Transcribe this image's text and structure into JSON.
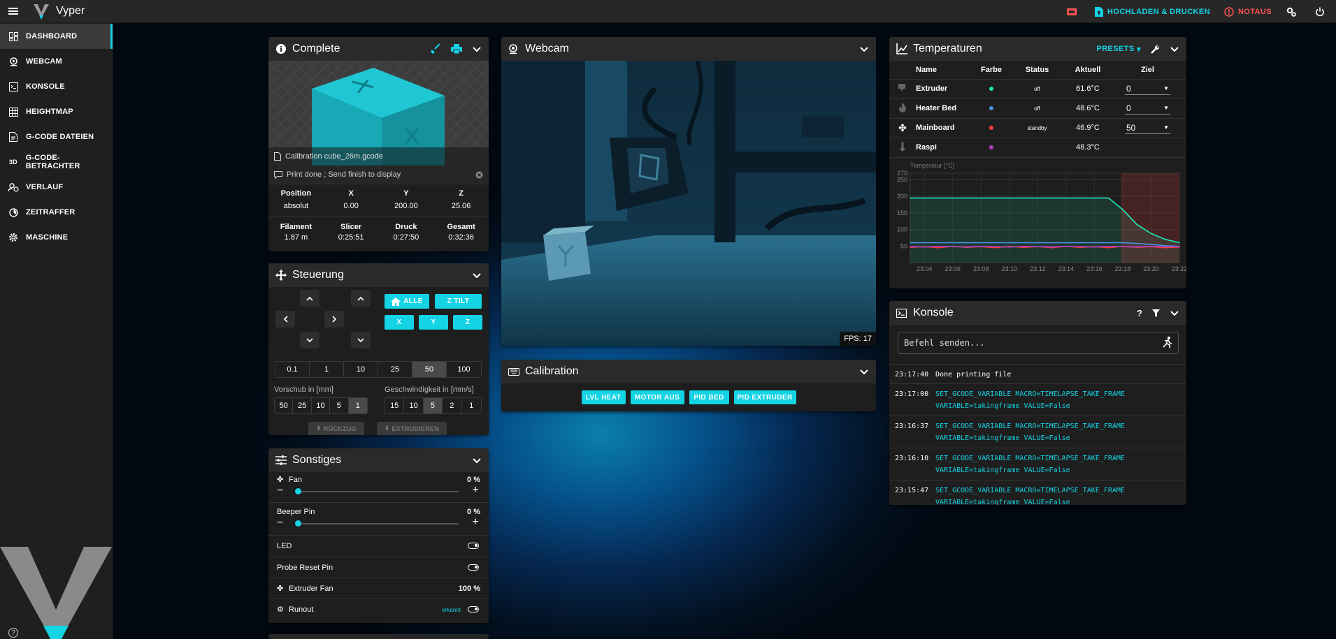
{
  "app": {
    "title": "Vyper"
  },
  "topbar": {
    "upload_label": "HOCHLADEN & DRUCKEN",
    "estop_label": "NOTAUS"
  },
  "sidebar": {
    "items": [
      {
        "label": "DASHBOARD",
        "icon": "dashboard-icon",
        "active": true
      },
      {
        "label": "WEBCAM",
        "icon": "webcam-icon"
      },
      {
        "label": "KONSOLE",
        "icon": "console-icon"
      },
      {
        "label": "HEIGHTMAP",
        "icon": "grid-icon"
      },
      {
        "label": "G-CODE DATEIEN",
        "icon": "file-icon"
      },
      {
        "label": "G-CODE-BETRACHTER",
        "icon": "3d-icon",
        "short": "3D"
      },
      {
        "label": "VERLAUF",
        "icon": "history-icon"
      },
      {
        "label": "ZEITRAFFER",
        "icon": "timelapse-icon"
      },
      {
        "label": "MASCHINE",
        "icon": "gear-icon"
      }
    ]
  },
  "status": {
    "title": "Complete",
    "filename": "Calibration cube_26m.gcode",
    "message": "Print done ; Send finish to display",
    "position": {
      "headers": [
        "Position",
        "X",
        "Y",
        "Z"
      ],
      "values": [
        "absolut",
        "0.00",
        "200.00",
        "25.06"
      ]
    },
    "stats": {
      "headers": [
        "Filament",
        "Slicer",
        "Druck",
        "Gesamt"
      ],
      "values": [
        "1.87 m",
        "0:25:51",
        "0:27:50",
        "0:32:36"
      ]
    }
  },
  "control": {
    "title": "Steuerung",
    "home_all": "ALLE",
    "z_tilt": "Z TILT",
    "home_x": "X",
    "home_y": "Y",
    "home_z": "Z",
    "steps": [
      "0.1",
      "1",
      "10",
      "25",
      "50",
      "100"
    ],
    "steps_selected": 4,
    "feed_label": "Vorschub in [mm]",
    "feed": [
      "50",
      "25",
      "10",
      "5",
      "1"
    ],
    "feed_selected": 4,
    "speed_label": "Geschwindigkeit in [mm/s]",
    "speed": [
      "15",
      "10",
      "5",
      "2",
      "1"
    ],
    "speed_selected": 2,
    "retract": "RÜCKZUG",
    "extrude": "EXTRUDIEREN"
  },
  "misc": {
    "title": "Sonstiges",
    "fan": {
      "label": "Fan",
      "value": "0 %",
      "level": 0
    },
    "beeper": {
      "label": "Beeper Pin",
      "value": "0 %",
      "level": 0
    },
    "led": {
      "label": "LED"
    },
    "probe": {
      "label": "Probe Reset Pin"
    },
    "extruder_fan": {
      "label": "Extruder Fan",
      "value": "100 %"
    },
    "runout": {
      "label": "Runout",
      "status": "erkannt"
    }
  },
  "webcam": {
    "title": "Webcam",
    "fps": "FPS: 17"
  },
  "calibration": {
    "title": "Calibration",
    "buttons": [
      "LVL HEAT",
      "MOTOR AUS",
      "PID BED",
      "PID EXTRUDER"
    ]
  },
  "temps": {
    "title": "Temperaturen",
    "presets": "PRESETS",
    "headers": [
      "Name",
      "Farbe",
      "Status",
      "Aktuell",
      "Ziel"
    ],
    "rows": [
      {
        "name": "Extruder",
        "color": "#1de9b6",
        "status": "off",
        "current": "61.6°C",
        "target": "0"
      },
      {
        "name": "Heater Bed",
        "color": "#4a90e2",
        "status": "off",
        "current": "48.6°C",
        "target": "0"
      },
      {
        "name": "Mainboard",
        "color": "#ff3b3b",
        "status": "standby",
        "current": "46.9°C",
        "target": "50"
      },
      {
        "name": "Raspi",
        "color": "#b040c0",
        "status": "",
        "current": "48.3°C",
        "target": ""
      }
    ]
  },
  "chart_data": {
    "type": "line",
    "ylabel": "Temperatur [°C]",
    "ylim": [
      0,
      270
    ],
    "yticks": [
      50,
      100,
      150,
      200,
      250,
      270
    ],
    "x": [
      "23:03",
      "23:04",
      "23:05",
      "23:06",
      "23:07",
      "23:08",
      "23:09",
      "23:10",
      "23:11",
      "23:12",
      "23:13",
      "23:14",
      "23:15",
      "23:16",
      "23:17",
      "23:18",
      "23:19",
      "23:20",
      "23:21",
      "23:22"
    ],
    "xticks": [
      "23:04",
      "23:06",
      "23:08",
      "23:10",
      "23:12",
      "23:14",
      "23:16",
      "23:18",
      "23:20",
      "23:22"
    ],
    "series": [
      {
        "color": "#1de9b6",
        "values": [
          195,
          195,
          195,
          195,
          195,
          195,
          195,
          195,
          195,
          195,
          195,
          195,
          195,
          195,
          195,
          160,
          115,
          88,
          70,
          60
        ]
      },
      {
        "color": "#4a90e2",
        "values": [
          60,
          60,
          60,
          60,
          60,
          60,
          60,
          60,
          60,
          60,
          60,
          60,
          60,
          60,
          60,
          60,
          58,
          55,
          51,
          49
        ]
      },
      {
        "color": "#ff3b3b",
        "values": [
          46,
          48,
          45,
          49,
          46,
          48,
          45,
          49,
          46,
          48,
          45,
          49,
          46,
          48,
          45,
          49,
          46,
          48,
          45,
          47
        ]
      },
      {
        "color": "#b040c0",
        "values": [
          48,
          47,
          49,
          48,
          47,
          49,
          48,
          47,
          49,
          48,
          47,
          49,
          48,
          47,
          49,
          48,
          47,
          49,
          48,
          48
        ]
      }
    ]
  },
  "console": {
    "title": "Konsole",
    "placeholder": "Befehl senden...",
    "entries": [
      {
        "time": "23:17:40",
        "msg": "Done printing file",
        "plain": true
      },
      {
        "time": "23:17:00",
        "msg": "SET_GCODE_VARIABLE MACRO=TIMELAPSE_TAKE_FRAME VARIABLE=takingframe VALUE=False"
      },
      {
        "time": "23:16:37",
        "msg": "SET_GCODE_VARIABLE MACRO=TIMELAPSE_TAKE_FRAME VARIABLE=takingframe VALUE=False"
      },
      {
        "time": "23:16:10",
        "msg": "SET_GCODE_VARIABLE MACRO=TIMELAPSE_TAKE_FRAME VARIABLE=takingframe VALUE=False"
      },
      {
        "time": "23:15:47",
        "msg": "SET_GCODE_VARIABLE MACRO=TIMELAPSE_TAKE_FRAME VARIABLE=takingframe VALUE=False"
      }
    ]
  }
}
